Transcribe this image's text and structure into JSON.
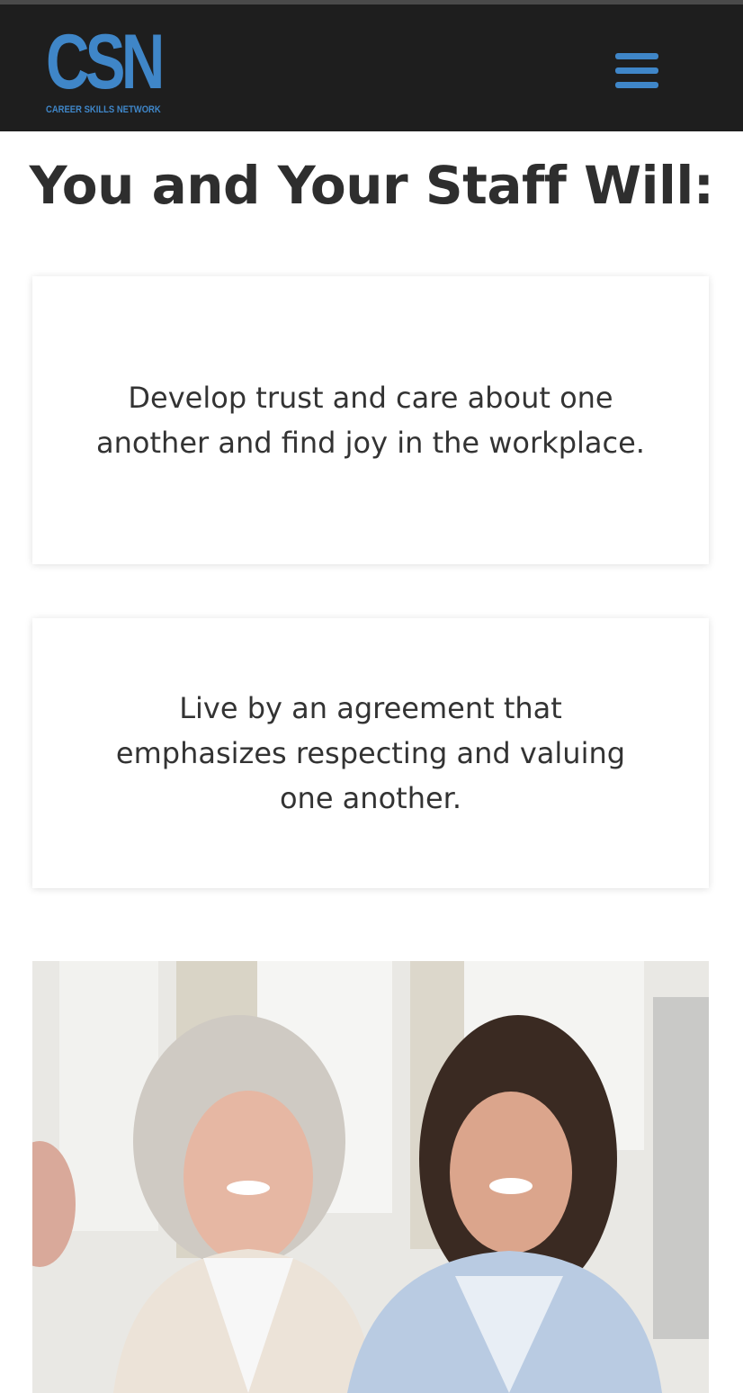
{
  "header": {
    "logo_text": "CSN",
    "logo_tagline": "CAREER SKILLS NETWORK",
    "menu_icon": "hamburger-menu-icon",
    "background_color": "#1e1e1e",
    "accent_color": "#3f86c8"
  },
  "main": {
    "headline": "You and Your Staff Will:",
    "cards": [
      {
        "text": "Develop trust and care about one another and find joy in the workplace."
      },
      {
        "text": "Live by an agreement that emphasizes respecting and valuing one another."
      }
    ]
  },
  "photo": {
    "subject": "smiling-women-photo"
  }
}
